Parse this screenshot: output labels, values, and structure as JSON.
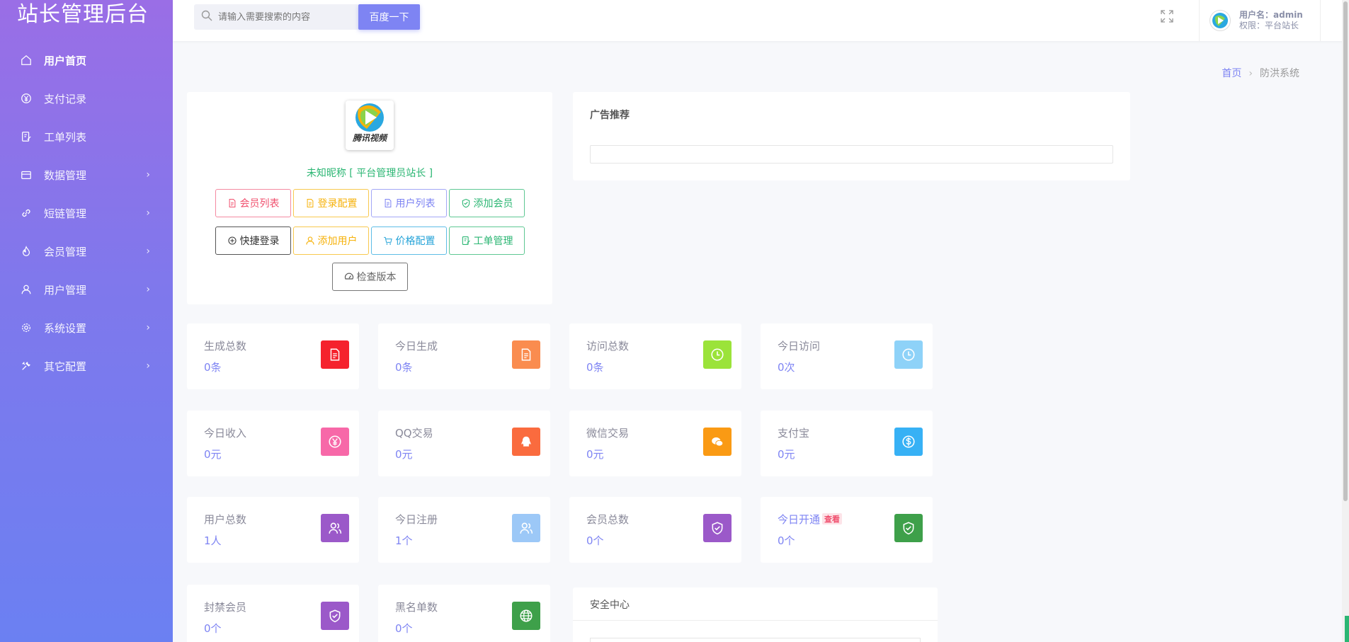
{
  "sidebar": {
    "title": "站长管理后台",
    "items": [
      {
        "label": "用户首页",
        "icon": "home-icon",
        "has_submenu": false,
        "active": true
      },
      {
        "label": "支付记录",
        "icon": "yen-circle-icon",
        "has_submenu": false
      },
      {
        "label": "工单列表",
        "icon": "ticket-edit-icon",
        "has_submenu": false
      },
      {
        "label": "数据管理",
        "icon": "database-icon",
        "has_submenu": true
      },
      {
        "label": "短链管理",
        "icon": "link-icon",
        "has_submenu": true
      },
      {
        "label": "会员管理",
        "icon": "fire-icon",
        "has_submenu": true
      },
      {
        "label": "用户管理",
        "icon": "user-icon",
        "has_submenu": true
      },
      {
        "label": "系统设置",
        "icon": "gear-icon",
        "has_submenu": true
      },
      {
        "label": "其它配置",
        "icon": "tools-icon",
        "has_submenu": true
      }
    ]
  },
  "header": {
    "search_placeholder": "请输入需要搜索的内容",
    "search_button": "百度一下",
    "username_line": "用户名：admin",
    "role_line": "权限：平台站长"
  },
  "breadcrumb": {
    "home": "首页",
    "current": "防洪系统"
  },
  "profile": {
    "logo_caption": "腾讯视频",
    "nickname_line": "未知昵称 [ 平台管理员站长 ]",
    "buttons": [
      {
        "label": "会员列表",
        "icon": "document-icon",
        "color": "red"
      },
      {
        "label": "登录配置",
        "icon": "document-icon",
        "color": "orange"
      },
      {
        "label": "用户列表",
        "icon": "document-icon",
        "color": "purple"
      },
      {
        "label": "添加会员",
        "icon": "shield-check-icon",
        "color": "green"
      },
      {
        "label": "快捷登录",
        "icon": "plus-circle-icon",
        "color": "dark"
      },
      {
        "label": "添加用户",
        "icon": "user-icon",
        "color": "orange"
      },
      {
        "label": "价格配置",
        "icon": "cart-icon",
        "color": "blue"
      },
      {
        "label": "工单管理",
        "icon": "ticket-edit-icon",
        "color": "green"
      }
    ],
    "check_version": "检查版本"
  },
  "ad": {
    "title": "广告推荐"
  },
  "stats": [
    {
      "label": "生成总数",
      "value": "0条",
      "icon": "document-icon",
      "color": "#f5222d"
    },
    {
      "label": "今日生成",
      "value": "0条",
      "icon": "document-icon",
      "color": "#fa8c4f"
    },
    {
      "label": "访问总数",
      "value": "0条",
      "icon": "clock-icon",
      "color": "#9be33a"
    },
    {
      "label": "今日访问",
      "value": "0次",
      "icon": "clock-icon",
      "color": "#8ed2f8"
    },
    {
      "label": "今日收入",
      "value": "0元",
      "icon": "yen-circle-icon",
      "color": "#f768a8"
    },
    {
      "label": "QQ交易",
      "value": "0元",
      "icon": "qq-icon",
      "color": "#fa6b3e"
    },
    {
      "label": "微信交易",
      "value": "0元",
      "icon": "wechat-icon",
      "color": "#fa9a14"
    },
    {
      "label": "支付宝",
      "value": "0元",
      "icon": "dollar-circle-icon",
      "color": "#37b1f5"
    },
    {
      "label": "用户总数",
      "value": "1人",
      "icon": "users-icon",
      "color": "#9b59c9"
    },
    {
      "label": "今日注册",
      "value": "1个",
      "icon": "users-icon",
      "color": "#9cc8f7"
    },
    {
      "label": "会员总数",
      "value": "0个",
      "icon": "shield-check-icon",
      "color": "#9b59c9"
    },
    {
      "label": "今日开通",
      "value": "0个",
      "icon": "shield-check-icon",
      "color": "#3ea04a",
      "tag": "查看"
    },
    {
      "label": "封禁会员",
      "value": "0个",
      "icon": "shield-check-icon",
      "color": "#9b59c9"
    },
    {
      "label": "黑名单数",
      "value": "0个",
      "icon": "globe-icon",
      "color": "#3ea04a"
    }
  ],
  "security": {
    "title": "安全中心"
  }
}
